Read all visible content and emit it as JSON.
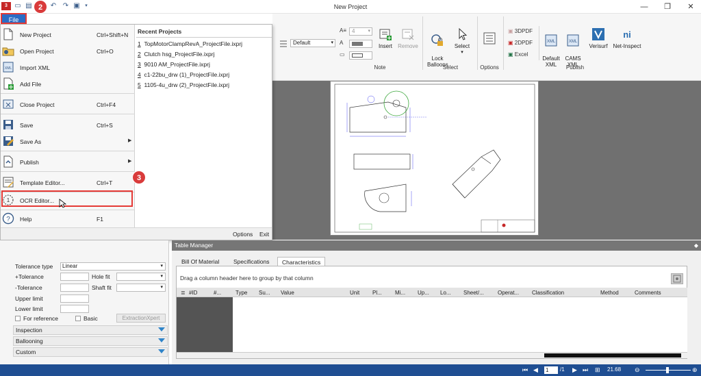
{
  "window": {
    "title": "New Project",
    "minimize": "—",
    "maximize": "❐",
    "close": "✕"
  },
  "file_tab": "File",
  "badges": {
    "step2": "2",
    "step3": "3"
  },
  "file_menu": {
    "items": [
      {
        "label": "New Project",
        "shortcut": "Ctrl+Shift+N"
      },
      {
        "label": "Open Project",
        "shortcut": "Ctrl+O"
      },
      {
        "label": "Import XML",
        "shortcut": ""
      },
      {
        "label": "Add File",
        "shortcut": ""
      },
      {
        "label": "Close Project",
        "shortcut": "Ctrl+F4"
      },
      {
        "label": "Save",
        "shortcut": "Ctrl+S"
      },
      {
        "label": "Save As",
        "shortcut": ""
      },
      {
        "label": "Publish",
        "shortcut": ""
      },
      {
        "label": "Template Editor...",
        "shortcut": "Ctrl+T"
      },
      {
        "label": "OCR Editor...",
        "shortcut": ""
      },
      {
        "label": "Help",
        "shortcut": "F1"
      }
    ],
    "recent_title": "Recent Projects",
    "recent": [
      {
        "num": "1",
        "name": "TopMotorClampRevA_ProjectFile.ixprj"
      },
      {
        "num": "2",
        "name": "Clutch hsg_ProjectFile.ixprj"
      },
      {
        "num": "3",
        "name": "9010 AM_ProjectFile.ixprj"
      },
      {
        "num": "4",
        "name": "c1-22bu_drw (1)_ProjectFile.ixprj"
      },
      {
        "num": "5",
        "name": "1105-4u_drw (2)_ProjectFile.ixprj"
      }
    ],
    "options": "Options",
    "exit": "Exit"
  },
  "ribbon": {
    "font_size": "4",
    "style_select": "Default",
    "note": {
      "insert": "Insert",
      "remove": "Remove",
      "label": "Note"
    },
    "select_group": {
      "lock": "Lock\nBalloons",
      "select": "Select",
      "label": "Select"
    },
    "options_group": {
      "options": "Options",
      "label": "Options"
    },
    "publish": {
      "3dpdf": "3DPDF",
      "2dpdf": "2DPDF",
      "excel": "Excel",
      "default_xml": "Default\nXML",
      "cams_xml": "CAMS\nXML",
      "verisurf": "Verisurf",
      "net_inspect": "Net-Inspect",
      "label": "Publish"
    },
    "colors": {
      "accent": "#2b6cc4",
      "highlight": "#e53935"
    }
  },
  "properties": {
    "tolerance_type_label": "Tolerance type",
    "tolerance_type_value": "Linear",
    "plus_tol": "+Tolerance",
    "minus_tol": "-Tolerance",
    "hole_fit": "Hole fit",
    "shaft_fit": "Shaft fit",
    "upper_limit": "Upper limit",
    "lower_limit": "Lower limit",
    "for_reference": "For reference",
    "basic": "Basic",
    "extraction": "ExtractionXpert",
    "sections": [
      "Inspection",
      "Ballooning",
      "Custom"
    ]
  },
  "table_manager": {
    "title": "Table Manager",
    "tabs": [
      "Bill Of Material",
      "Specifications",
      "Characteristics"
    ],
    "group_hint": "Drag a column header here to group by that column",
    "columns": [
      "#ID",
      "#...",
      "Type",
      "Su...",
      "Value",
      "Unit",
      "Pl...",
      "Mi...",
      "Up...",
      "Lo...",
      "Sheet/...",
      "Operat...",
      "Classification",
      "Method",
      "Comments"
    ]
  },
  "status": {
    "page": "1",
    "page_total": "/1",
    "zoom": "21.68"
  }
}
